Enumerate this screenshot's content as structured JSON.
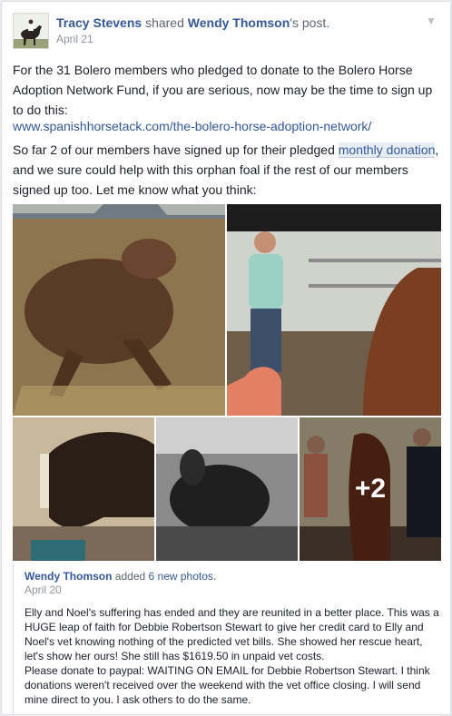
{
  "post": {
    "author": "Tracy Stevens",
    "action": "shared",
    "original_author": "Wendy Thomson",
    "possessive": "'s post.",
    "timestamp": "April 21",
    "para1": "For the 31 Bolero members who pledged to donate to the Bolero Horse Adoption Network Fund, if you are serious, now may be the time to sign up to do this:",
    "link": "www.spanishhorsetack.com/the-bolero-horse-adoption-network/",
    "para2_before": "So far 2 of our members have signed up for their pledged ",
    "para2_highlight": "monthly donation",
    "para2_after": ", and we sure could help with this orphan foal if the rest of our members signed up too. Let me know what you think:"
  },
  "photos": {
    "more_count": "+2"
  },
  "shared_post": {
    "author": "Wendy Thomson",
    "action": "added",
    "photos_link": "6 new photos",
    "period": ".",
    "timestamp": "April 20",
    "body_line1": "Elly and Noel's suffering has ended and they are reunited in a better place. This was a HUGE leap of faith for Debbie Robertson Stewart to give her credit card to Elly and Noel's vet knowing nothing of the predicted vet bills. She showed her rescue heart, let's show her ours! She still has $1619.50 in unpaid vet costs.",
    "body_line2": "Please donate to paypal: WAITING ON EMAIL for Debbie Robertson Stewart. I think donations weren't received over the weekend with the vet office closing. I will send mine direct to you. I ask others to do the same."
  },
  "icons": {
    "menu": "chevron-down-icon"
  },
  "colors": {
    "link": "#365899",
    "text": "#1d2129",
    "muted": "#90949c",
    "highlight_bg": "#e8ecf4"
  }
}
